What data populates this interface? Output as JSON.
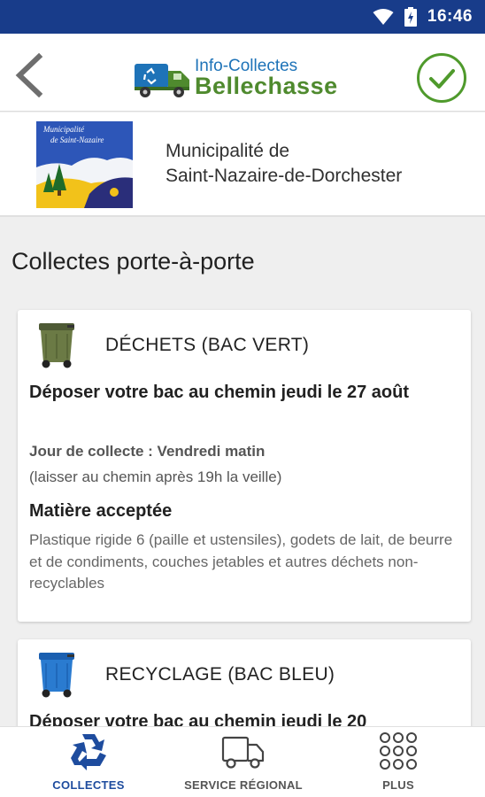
{
  "status_bar": {
    "time": "16:46"
  },
  "app_bar": {
    "logo_line1": "Info-Collectes",
    "logo_line2": "Bellechasse",
    "colors": {
      "primary_blue": "#1e73b8",
      "green": "#4f8a2e",
      "status_bar": "#183c8a"
    }
  },
  "municipality": {
    "logo_text_line1": "Municipalité",
    "logo_text_line2": "de Saint-Nazaire",
    "name_line1": "Municipalité de",
    "name_line2": "Saint-Nazaire-de-Dorchester"
  },
  "page": {
    "section_title": "Collectes porte-à-porte"
  },
  "cards": [
    {
      "title": "DÉCHETS (BAC VERT)",
      "bin_icon": "green-bin-icon",
      "deposit": "Déposer votre bac au chemin jeudi le 27 août",
      "jour": "Jour de collecte : Vendredi matin",
      "note": "(laisser au chemin après 19h la veille)",
      "material_title": "Matière acceptée",
      "material_text": "Plastique rigide 6 (paille et ustensiles), godets de lait, de beurre et de condiments, couches jetables et autres déchets non-recyclables"
    },
    {
      "title": "RECYCLAGE (BAC BLEU)",
      "bin_icon": "blue-bin-icon",
      "deposit": "Déposer votre bac au chemin jeudi le 20"
    }
  ],
  "bottom_nav": {
    "items": [
      {
        "label": "COLLECTES",
        "icon": "recycle-icon",
        "active": true
      },
      {
        "label": "SERVICE RÉGIONAL",
        "icon": "truck-icon",
        "active": false
      },
      {
        "label": "PLUS",
        "icon": "grid-icon",
        "active": false
      }
    ]
  }
}
